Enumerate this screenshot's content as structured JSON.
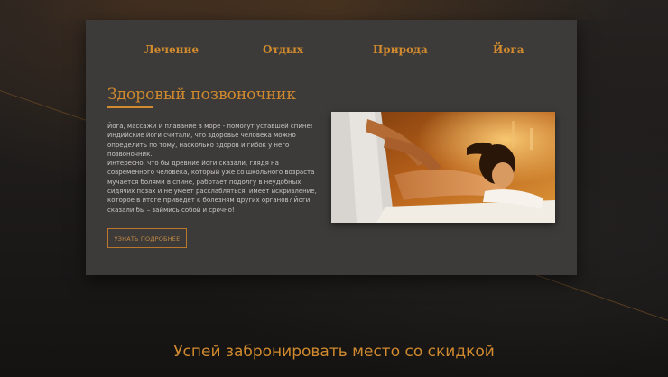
{
  "nav": {
    "items": [
      {
        "label": "Лечение"
      },
      {
        "label": "Отдых"
      },
      {
        "label": "Природа"
      },
      {
        "label": "Йога"
      }
    ]
  },
  "section": {
    "title": "Здоровый позвоночник",
    "paragraphs": [
      "Йога, массажи и плавание в море - помогут уставшей спине! Индийские йоги считали, что здоровье человека можно определить по тому, насколько здоров и гибок у него позвоночник.",
      "Интересно, что бы древние йоги сказали, глядя на современного человека, который уже со школьного возраста мучается болями в спине, работает подолгу в неудобных сидячих позах и не умеет расслабляться, имеет искривление, которое в итоге приведет к болезням других органов? Йоги сказали бы – займись собой и срочно!"
    ],
    "more_button": "УЗНАТЬ ПОДРОБНЕЕ"
  },
  "promo": {
    "text": "Успей забронировать место со скидкой"
  },
  "colors": {
    "accent": "#d18a2e",
    "card_bg": "#3c3b3a",
    "page_bg": "#1c1a19"
  }
}
